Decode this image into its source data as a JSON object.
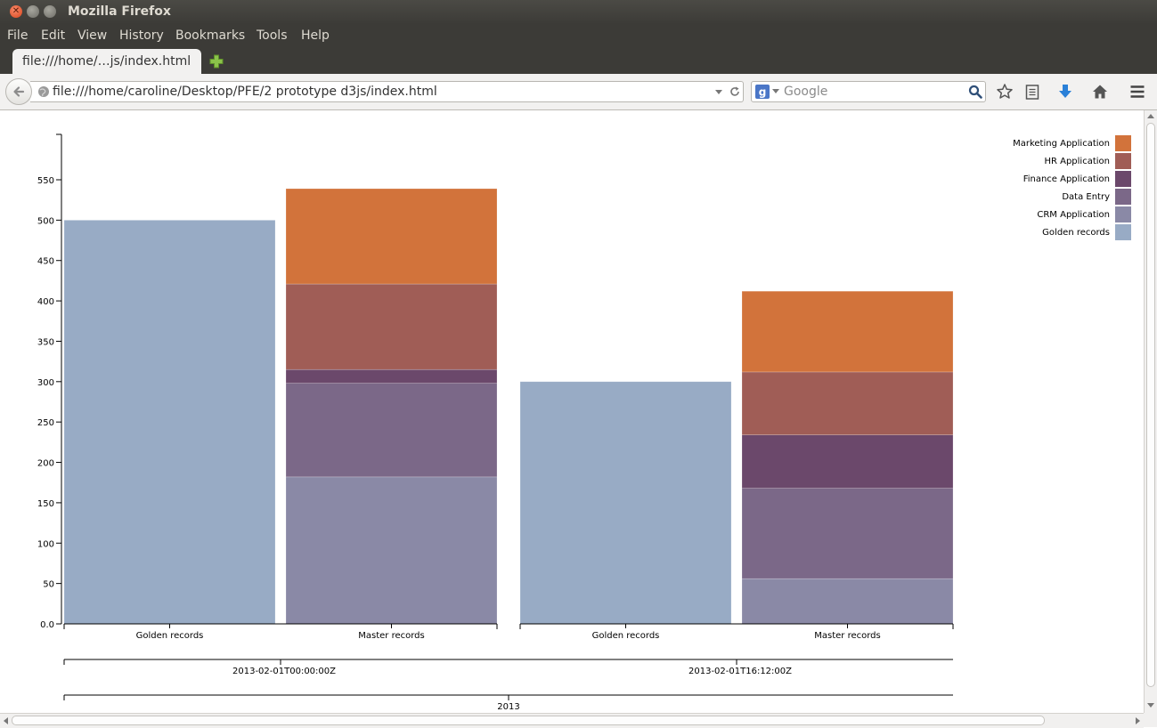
{
  "window": {
    "title": "Mozilla Firefox"
  },
  "menu": {
    "items": [
      "File",
      "Edit",
      "View",
      "History",
      "Bookmarks",
      "Tools",
      "Help"
    ]
  },
  "tab": {
    "title": "file:///home/…js/index.html"
  },
  "navbar": {
    "url": "file:///home/caroline/Desktop/PFE/2 prototype d3js/index.html",
    "search_placeholder": "Google"
  },
  "icons": {
    "back": "back-arrow-icon",
    "site_identity": "globe-icon",
    "url_dropdown": "chevron-down-icon",
    "reload": "reload-icon",
    "search_engine": "google-icon",
    "search": "search-icon",
    "bookmark": "star-icon",
    "reading_list": "clipboard-icon",
    "downloads": "download-arrow-icon",
    "home": "home-icon",
    "menu": "hamburger-icon",
    "new_tab": "plus-icon"
  },
  "chart_data": {
    "type": "bar",
    "stacked": true,
    "ylim": [
      0,
      550
    ],
    "yticks": [
      0,
      50,
      100,
      150,
      200,
      250,
      300,
      350,
      400,
      450,
      500,
      550
    ],
    "ytick_labels": [
      "0.0",
      "50",
      "100",
      "150",
      "200",
      "250",
      "300",
      "350",
      "400",
      "450",
      "500",
      "550"
    ],
    "groups": [
      {
        "label": "2013-02-01T00:00:00Z",
        "bars": [
          {
            "label": "Golden records",
            "segments": [
              {
                "series": "Golden records",
                "value": 500
              }
            ]
          },
          {
            "label": "Master records",
            "segments": [
              {
                "series": "CRM Application",
                "value": 182
              },
              {
                "series": "Data Entry",
                "value": 116
              },
              {
                "series": "Finance Application",
                "value": 17
              },
              {
                "series": "HR Application",
                "value": 106
              },
              {
                "series": "Marketing Application",
                "value": 118
              }
            ]
          }
        ]
      },
      {
        "label": "2013-02-01T16:12:00Z",
        "bars": [
          {
            "label": "Golden records",
            "segments": [
              {
                "series": "Golden records",
                "value": 300
              }
            ]
          },
          {
            "label": "Master records",
            "segments": [
              {
                "series": "CRM Application",
                "value": 56
              },
              {
                "series": "Data Entry",
                "value": 112
              },
              {
                "series": "Finance Application",
                "value": 66
              },
              {
                "series": "HR Application",
                "value": 78
              },
              {
                "series": "Marketing Application",
                "value": 100
              }
            ]
          }
        ]
      }
    ],
    "year_label": "2013",
    "legend": {
      "placement": "top-right",
      "entries": [
        {
          "name": "Marketing Application",
          "color": "#d2733b"
        },
        {
          "name": "HR Application",
          "color": "#a05d56"
        },
        {
          "name": "Finance Application",
          "color": "#6b486b"
        },
        {
          "name": "Data Entry",
          "color": "#7b6888"
        },
        {
          "name": "CRM Application",
          "color": "#8a89a6"
        },
        {
          "name": "Golden records",
          "color": "#98abc5"
        }
      ]
    }
  }
}
